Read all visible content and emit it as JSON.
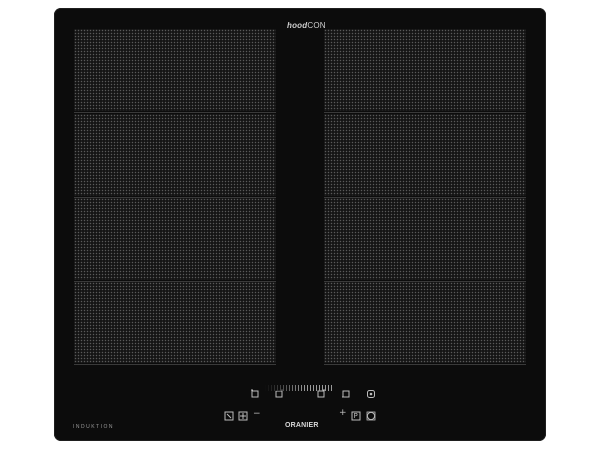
{
  "branding": {
    "hood_prefix": "hood",
    "hood_suffix": "CON",
    "induction_label": "INDUKTION",
    "maker": "ORANIER"
  },
  "cooking_zones": {
    "left": [
      "zone-left-1",
      "zone-left-2",
      "zone-left-3",
      "zone-left-4"
    ],
    "right": [
      "zone-right-1",
      "zone-right-2",
      "zone-right-3",
      "zone-right-4"
    ]
  },
  "controls": {
    "minus": "−",
    "plus": "+",
    "pause": "P",
    "icons": [
      "bridge-left-icon",
      "bridge-left-2-icon",
      "bridge-right-icon",
      "bridge-right-2-icon",
      "lock-icon",
      "timer-icon",
      "flex-icon",
      "power-icon"
    ]
  },
  "colors": {
    "glass": "#0c0c0c",
    "dots": "#5a5a5a",
    "text": "#bdbdbd"
  }
}
